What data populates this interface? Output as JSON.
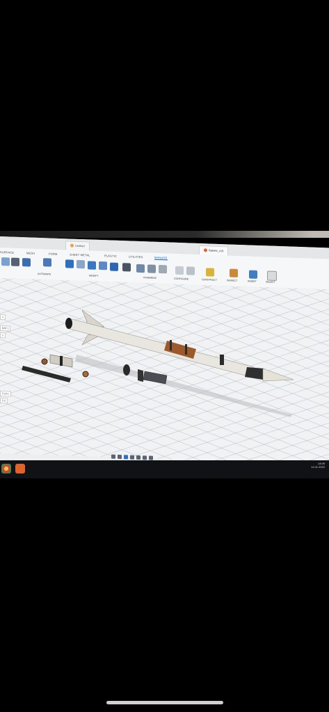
{
  "window": {
    "doc_tabs": [
      {
        "label": "Untitled"
      },
      {
        "label": "Rakete_v10"
      }
    ]
  },
  "ribbon": {
    "tabs": [
      "SURFACE",
      "MESH",
      "FORM",
      "SHEET METAL",
      "PLASTIC",
      "UTILITIES",
      "MANAGE"
    ],
    "active_tab": "MANAGE",
    "groups": [
      "AUTOMATE",
      "MODIFY",
      "ASSEMBLE",
      "CONFIGURE",
      "CONSTRUCT",
      "INSPECT",
      "INSERT",
      "SELECT"
    ]
  },
  "browser": {
    "items": [
      "1",
      "EAT 1",
      "1",
      "5 10 1",
      "5 2"
    ]
  },
  "taskbar": {
    "tray_time": "14:09",
    "tray_date": "14.11.2022"
  },
  "colors": {
    "rocket_body": "#e9e6df",
    "rocket_dark": "#1c1c1c",
    "copper": "#9c5a2a",
    "accent": "#0b62c8"
  },
  "icons": [
    "automate-icon",
    "modify-icon",
    "assemble-icon",
    "configure-icon",
    "construct-icon",
    "inspect-icon",
    "insert-icon",
    "select-icon",
    "orbit-icon",
    "pan-icon",
    "zoom-icon",
    "fit-icon",
    "display-icon",
    "grid-icon",
    "viewports-icon"
  ]
}
